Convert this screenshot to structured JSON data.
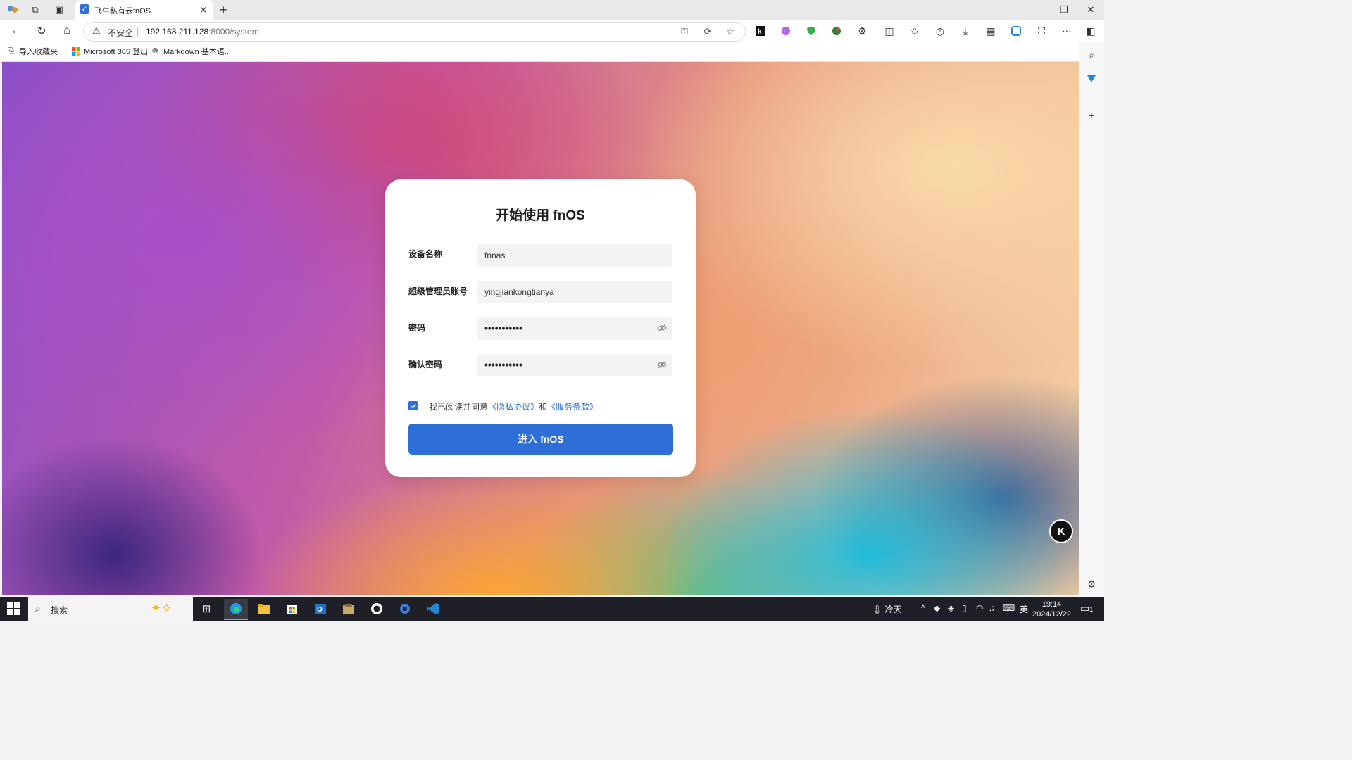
{
  "browser": {
    "tab_title": "飞牛私有云fnOS",
    "tab_favicon": "fnOS logo",
    "insecure_label": "不安全",
    "url_host": "192.168.211.128",
    "url_path": ":8000/system"
  },
  "bookmarks": [
    {
      "label": "导入收藏夹",
      "icon": "import-favorites-icon"
    },
    {
      "label": "Microsoft 365 登出",
      "icon": "microsoft-logo-icon"
    },
    {
      "label": "Markdown 基本语...",
      "icon": "globe-icon"
    }
  ],
  "card": {
    "title": "开始使用 fnOS",
    "fields": [
      {
        "label": "设备名称",
        "value": "fnnas"
      },
      {
        "label": "超级管理员账号",
        "value": "yingjiankongtianya"
      },
      {
        "label": "密码",
        "value": "•••••••••••"
      },
      {
        "label": "确认密码",
        "value": "•••••••••••"
      }
    ],
    "agree_prefix": "我已阅读并同意",
    "privacy_link": "《隐私协议》",
    "agree_and": "和",
    "terms_link": "《服务条款》",
    "agree_checked": true,
    "submit_label": "进入 fnOS"
  },
  "floating_badge": "K",
  "taskbar": {
    "search_placeholder": "搜索",
    "weather": "冷天",
    "ime": "英",
    "time": "19:14",
    "date": "2024/12/22",
    "notification_count": "1"
  },
  "colors": {
    "primary": "#2d6fd6",
    "card_bg": "#ffffff",
    "input_bg": "#f2f3f5",
    "taskbar_bg": "#1f2027"
  }
}
